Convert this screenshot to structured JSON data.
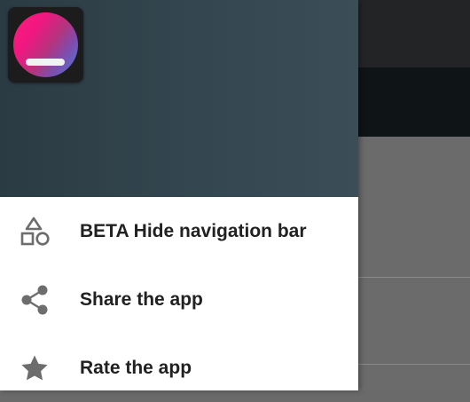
{
  "drawer": {
    "items": [
      {
        "label": "BETA Hide navigation bar",
        "icon": "shapes-icon"
      },
      {
        "label": "Share the app",
        "icon": "share-icon"
      },
      {
        "label": "Rate the app",
        "icon": "star-icon"
      }
    ]
  },
  "colors": {
    "header_gradient_start": "#2b3b44",
    "header_gradient_end": "#3b4d57",
    "icon": "#6d6d6d",
    "label": "#212121",
    "toggle_accent": "#0f6b78"
  }
}
